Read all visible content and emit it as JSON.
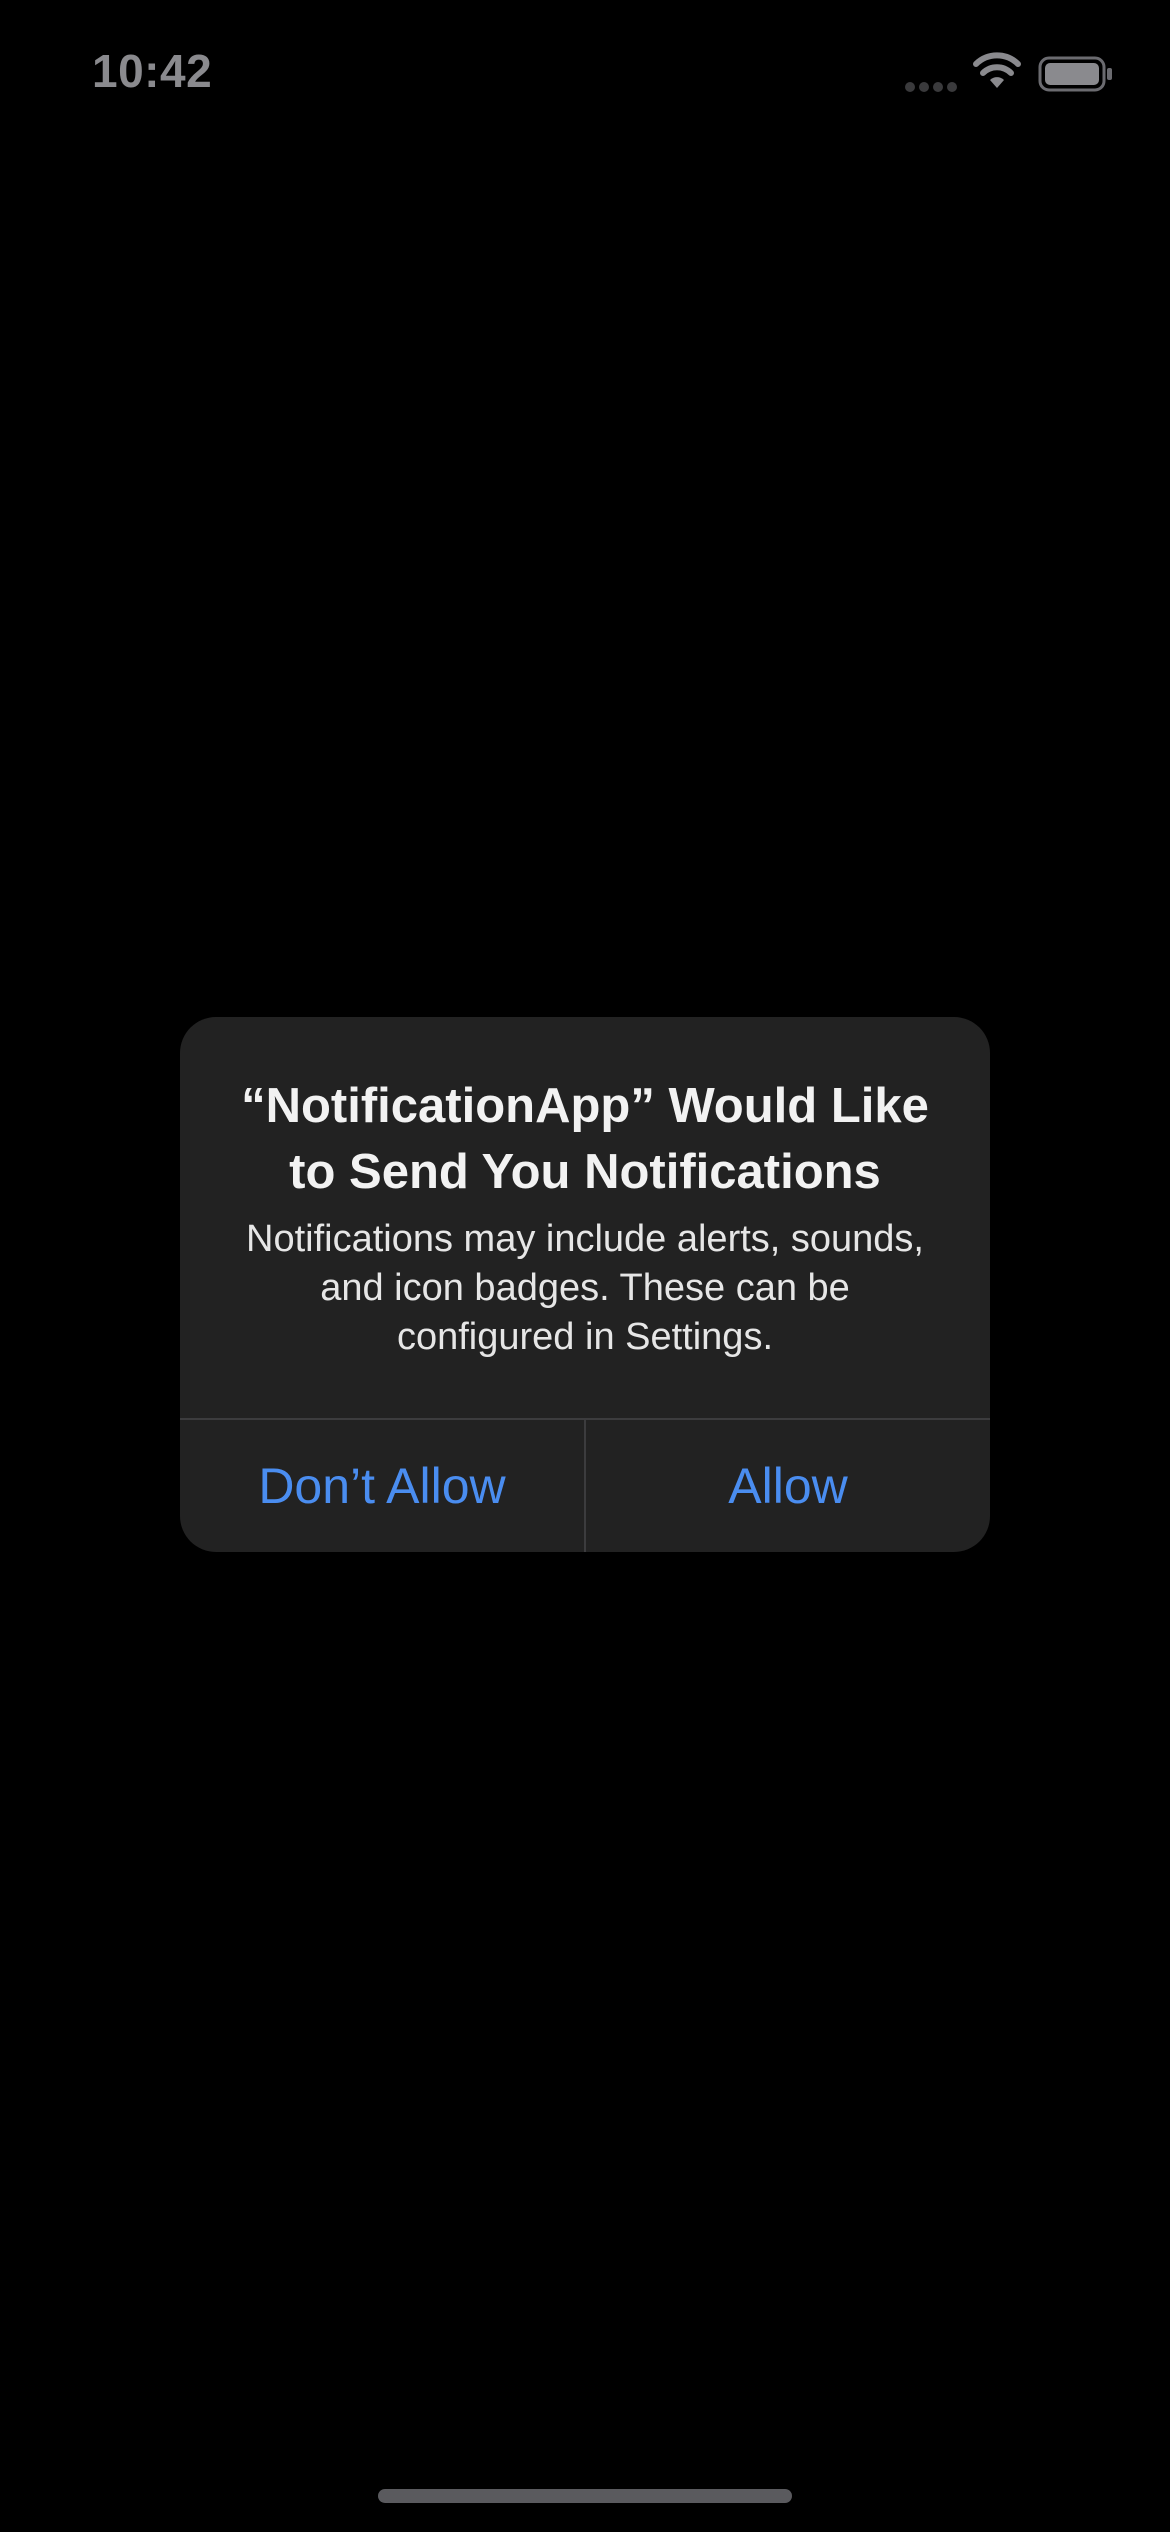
{
  "status_bar": {
    "time": "10:42",
    "icons": [
      "cellular-signal-icon",
      "wifi-icon",
      "battery-icon"
    ]
  },
  "alert": {
    "title": "“NotificationApp” Would Like to Send You Notifications",
    "message": "Notifications may include alerts, sounds, and icon badges. These can be configured in Settings.",
    "buttons": {
      "deny_label": "Don’t Allow",
      "allow_label": "Allow"
    }
  },
  "colors": {
    "background": "#000000",
    "alert_background": "#222222",
    "button_text": "#4a8df0",
    "status_text": "#8a8a8e"
  }
}
